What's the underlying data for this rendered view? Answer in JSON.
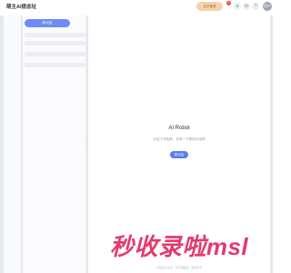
{
  "header": {
    "brand": "萌主AI提念址",
    "chip_label": "会员套餐",
    "notification_count": "3",
    "icon_buttons": [
      "bell-icon",
      "settings-icon",
      "help-icon"
    ],
    "avatar_label": "用户"
  },
  "sidebar": {
    "new_chat_label": "新对话",
    "collapse_glyph": "‹"
  },
  "main": {
    "title": "AI Robot",
    "subtitle": "点这下开始呢，并带一个新的对话吧",
    "start_label": "新对话"
  },
  "watermark": "秒收录啦msl",
  "footer": "内容由AI生成，请仔细甄别 · 版权所有",
  "colors": {
    "accent": "#5b7ef0",
    "chip_bg": "#f4d3b0",
    "watermark": "#e23b6f",
    "frame": "#e6e8ef"
  }
}
